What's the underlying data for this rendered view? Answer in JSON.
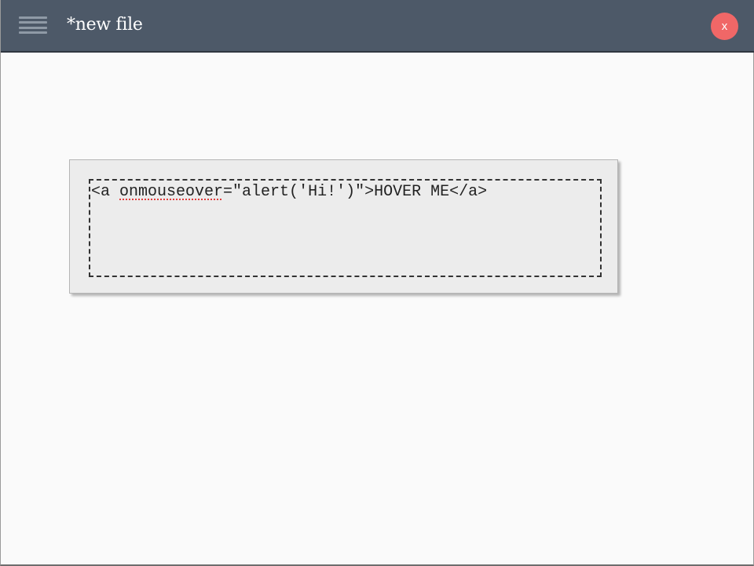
{
  "window": {
    "title": "*new file",
    "close_label": "x"
  },
  "editor": {
    "code_prefix": "<a ",
    "code_misspelled": "onmouseover",
    "code_suffix": "=\"alert('Hi!')\">HOVER ME</a>"
  },
  "icons": {
    "menu": "hamburger-menu-icon"
  },
  "colors": {
    "titlebar": "#4d5968",
    "close_button": "#f06767",
    "card_background": "#ececec",
    "page_background": "#fafafa",
    "spellcheck_underline": "#e23c3c"
  }
}
